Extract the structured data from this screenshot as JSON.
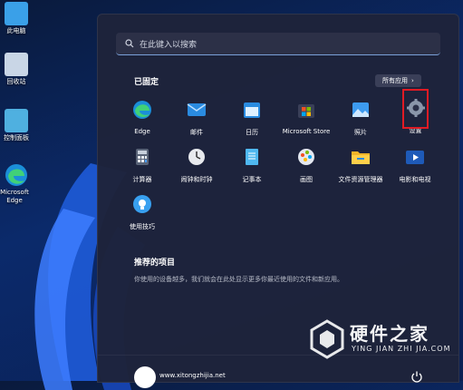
{
  "desktop": {
    "icons": [
      {
        "label": "此电脑",
        "icon": "computer-icon"
      },
      {
        "label": "回收站",
        "icon": "recycle-bin-icon"
      },
      {
        "label": "控制面板",
        "icon": "control-panel-icon"
      },
      {
        "label": "Microsoft Edge",
        "icon": "edge-icon"
      }
    ]
  },
  "start_menu": {
    "search_placeholder": "在此键入以搜索",
    "pinned_title": "已固定",
    "all_apps_label": "所有应用",
    "pinned_apps": [
      {
        "label": "Edge",
        "icon": "edge-icon"
      },
      {
        "label": "邮件",
        "icon": "mail-icon"
      },
      {
        "label": "日历",
        "icon": "calendar-icon"
      },
      {
        "label": "Microsoft Store",
        "icon": "store-icon"
      },
      {
        "label": "照片",
        "icon": "photos-icon"
      },
      {
        "label": "设置",
        "icon": "settings-icon",
        "highlighted": true
      },
      {
        "label": "计算器",
        "icon": "calculator-icon"
      },
      {
        "label": "闹钟和时钟",
        "icon": "clock-icon"
      },
      {
        "label": "记事本",
        "icon": "notepad-icon"
      },
      {
        "label": "画图",
        "icon": "paint-icon"
      },
      {
        "label": "文件资源管理器",
        "icon": "folder-icon"
      },
      {
        "label": "电影和电视",
        "icon": "movies-icon"
      },
      {
        "label": "使用技巧",
        "icon": "tips-icon"
      }
    ],
    "recommended_title": "推荐的项目",
    "recommended_text": "你使用的设备越多，我们就会在此处显示更多你最近使用的文件和新应用。",
    "user_name": "www.xitongzhijia.net"
  },
  "watermark": {
    "title": "硬件之家",
    "subtitle": "YING JIAN ZHI JIA.COM"
  },
  "colors": {
    "highlight_border": "#e01b24",
    "accent_blue": "#0078d4"
  }
}
